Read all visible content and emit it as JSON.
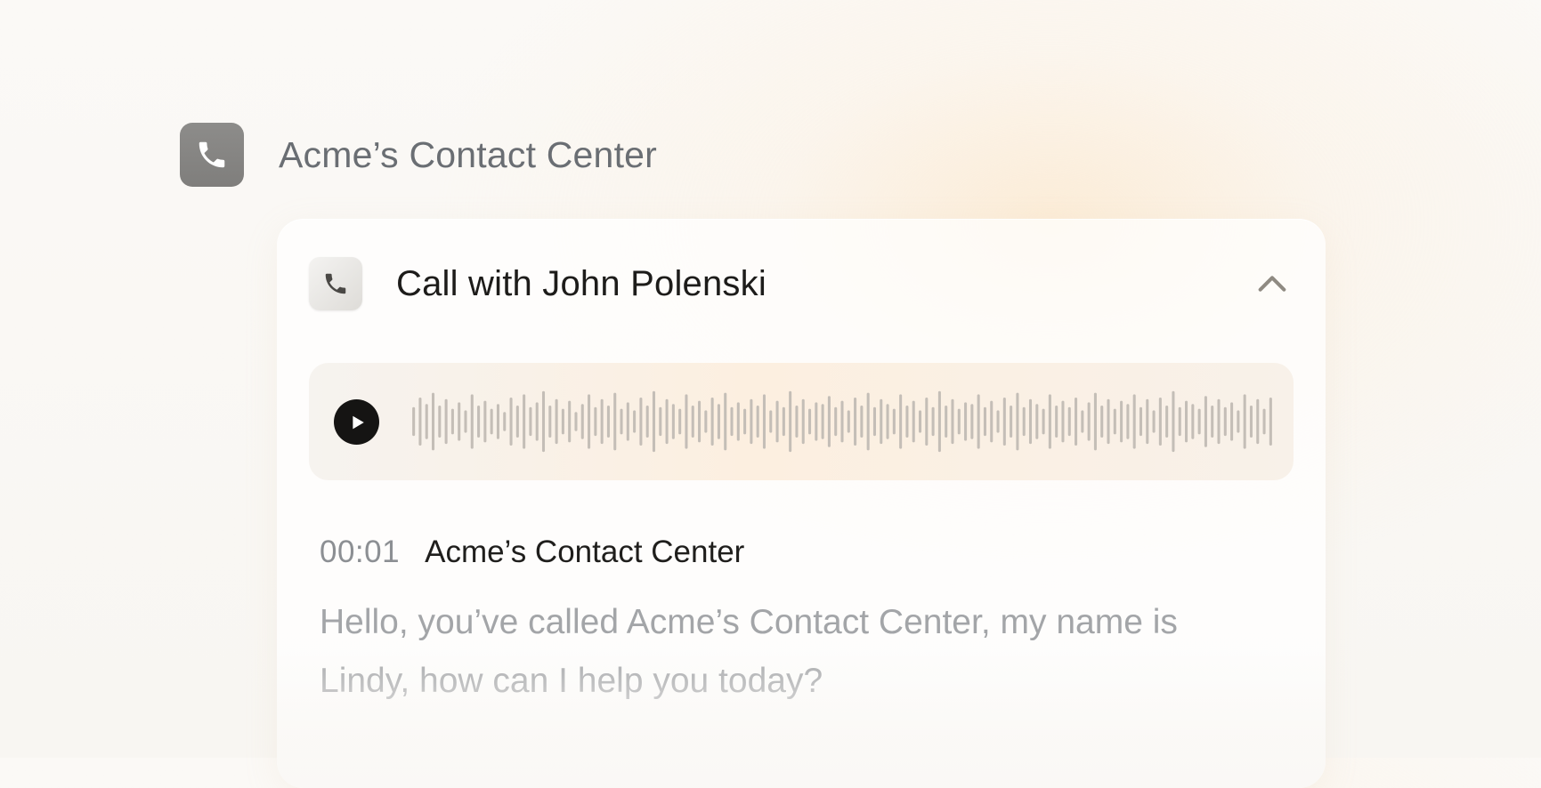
{
  "app": {
    "title": "Acme’s Contact Center",
    "icon": "phone-icon"
  },
  "call": {
    "title": "Call with John Polenski",
    "icon": "phone-icon",
    "collapse_icon": "chevron-up-icon"
  },
  "player": {
    "play_icon": "play-icon",
    "waveform_levels": [
      0.45,
      0.75,
      0.55,
      0.9,
      0.5,
      0.7,
      0.4,
      0.6,
      0.35,
      0.85,
      0.5,
      0.65,
      0.4,
      0.55,
      0.3,
      0.75,
      0.5,
      0.85,
      0.45,
      0.6,
      0.95,
      0.5,
      0.7,
      0.4,
      0.65,
      0.3,
      0.55,
      0.85,
      0.45,
      0.7,
      0.5,
      0.9,
      0.4,
      0.6,
      0.35,
      0.75,
      0.5,
      0.95,
      0.45,
      0.7,
      0.55,
      0.4,
      0.85,
      0.5,
      0.65,
      0.35,
      0.75,
      0.55,
      0.9,
      0.45,
      0.6,
      0.4,
      0.7,
      0.5,
      0.85,
      0.35,
      0.65,
      0.45,
      0.95,
      0.5,
      0.7,
      0.4,
      0.6,
      0.55,
      0.8,
      0.45,
      0.65,
      0.35,
      0.75,
      0.5,
      0.9,
      0.45,
      0.7,
      0.55,
      0.4,
      0.85,
      0.5,
      0.65,
      0.35,
      0.75,
      0.45,
      0.95,
      0.5,
      0.7,
      0.4,
      0.6,
      0.55,
      0.85,
      0.45,
      0.65,
      0.35,
      0.75,
      0.5,
      0.9,
      0.45,
      0.7,
      0.55,
      0.4,
      0.85,
      0.5,
      0.65,
      0.45,
      0.75,
      0.35,
      0.6,
      0.9,
      0.5,
      0.7,
      0.4,
      0.65,
      0.55,
      0.85,
      0.45,
      0.7,
      0.35,
      0.75,
      0.5,
      0.95,
      0.45,
      0.65,
      0.55,
      0.4,
      0.8,
      0.5,
      0.7,
      0.45,
      0.6,
      0.35,
      0.85,
      0.5,
      0.7,
      0.4,
      0.75
    ]
  },
  "colors": {
    "app_icon_bg": "#868583",
    "play_button": "#151413",
    "waveform": "#c4beb7",
    "accent_glow": "#fce8cd"
  },
  "transcript": [
    {
      "time": "00:01",
      "speaker": "Acme’s Contact Center",
      "text": "Hello, you’ve called Acme’s Contact Center, my name is Lindy, how can I help you today?"
    }
  ]
}
